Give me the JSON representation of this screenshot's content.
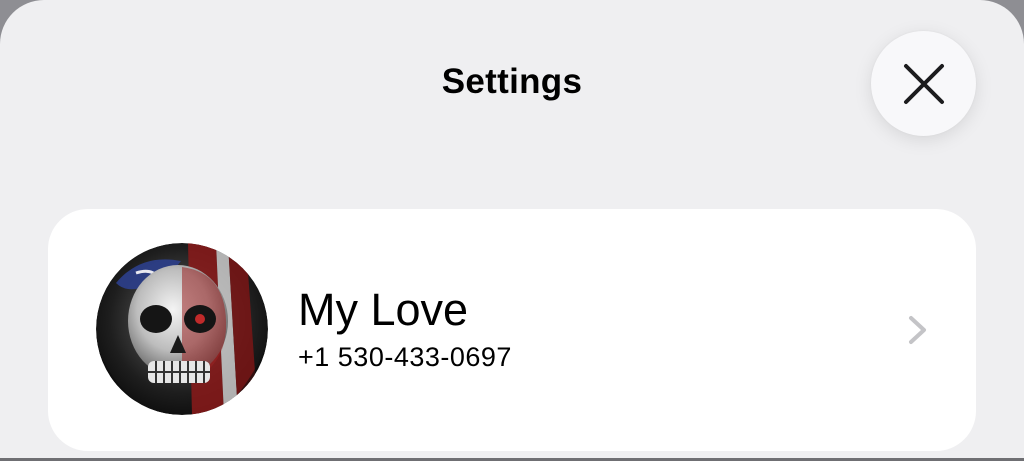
{
  "header": {
    "title": "Settings",
    "close_icon": "close-icon"
  },
  "profile": {
    "name": "My Love",
    "phone": "+1 530-433-0697",
    "avatar_icon": "skull-flag-avatar",
    "chevron_icon": "chevron-right-icon"
  },
  "colors": {
    "sheet_background": "#efeff1",
    "card_background": "#ffffff",
    "chevron": "#c4c4c7",
    "text": "#000000"
  }
}
